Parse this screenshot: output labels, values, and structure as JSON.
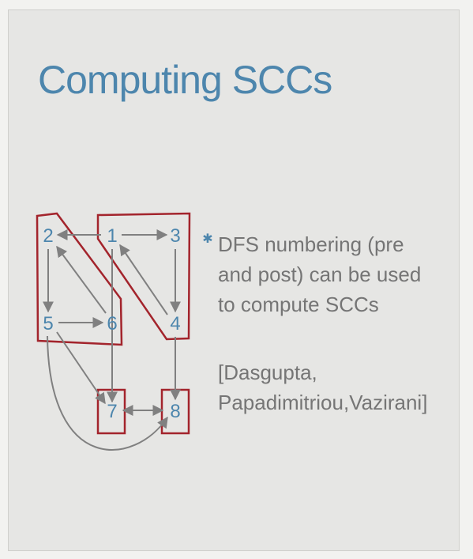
{
  "slide": {
    "title": "Computing SCCs",
    "bullet_text": "DFS numbering (pre and post) can be used to compute SCCs",
    "citation_line1": "[Dasgupta,",
    "citation_line2": "Papadimitriou,Vazirani]"
  },
  "graph": {
    "nodes": [
      "1",
      "2",
      "3",
      "4",
      "5",
      "6",
      "7",
      "8"
    ],
    "edges": [
      [
        "1",
        "2"
      ],
      [
        "1",
        "3"
      ],
      [
        "3",
        "4"
      ],
      [
        "4",
        "1"
      ],
      [
        "1",
        "7"
      ],
      [
        "2",
        "5"
      ],
      [
        "5",
        "6"
      ],
      [
        "6",
        "2"
      ],
      [
        "5",
        "7"
      ],
      [
        "5",
        "8"
      ],
      [
        "6",
        "7"
      ],
      [
        "4",
        "8"
      ],
      [
        "7",
        "8"
      ],
      [
        "8",
        "7"
      ]
    ],
    "components": [
      [
        "2",
        "5",
        "6"
      ],
      [
        "1",
        "3",
        "4"
      ],
      [
        "7"
      ],
      [
        "8"
      ]
    ],
    "colors": {
      "node": "#4d86ad",
      "edge": "#808080",
      "component": "#a3242c"
    }
  }
}
